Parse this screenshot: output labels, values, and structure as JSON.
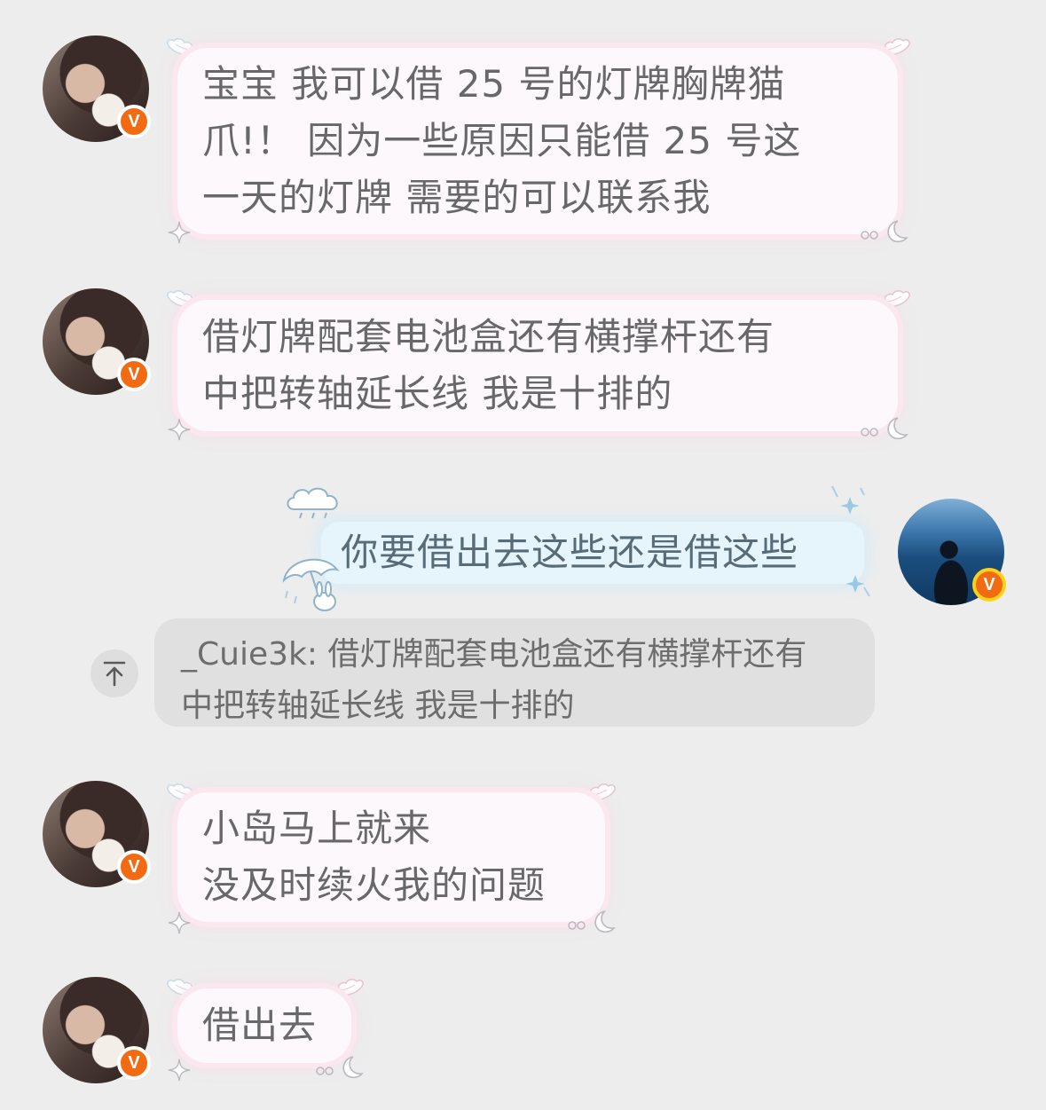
{
  "messages": [
    {
      "direction": "incoming",
      "lines": [
        "宝宝 我可以借 25 号的灯牌胸牌猫",
        "爪!！ 因为一些原因只能借 25 号这",
        "一天的灯牌 需要的可以联系我"
      ]
    },
    {
      "direction": "incoming",
      "lines": [
        "借灯牌配套电池盒还有横撑杆还有",
        "中把转轴延长线 我是十排的"
      ]
    },
    {
      "direction": "outgoing",
      "lines": [
        "你要借出去这些还是借这些"
      ]
    },
    {
      "direction": "incoming",
      "lines": [
        "小岛马上就来",
        "没及时续火我的问题"
      ]
    },
    {
      "direction": "incoming",
      "lines": [
        "借出去"
      ]
    }
  ],
  "quote": {
    "lines": [
      "_Cuie3k: 借灯牌配套电池盒还有横撑杆还有",
      "中把转轴延长线 我是十排的"
    ]
  },
  "badge_label": "V",
  "icons": {
    "badge": "verified-v-icon",
    "quote_jump": "arrow-up-to-top-icon",
    "wing": "angel-wing-icon",
    "sparkle": "sparkle-star-icon",
    "moon": "crescent-moon-icon",
    "cloud": "rain-cloud-icon",
    "umbrella": "umbrella-bunny-icon"
  },
  "colors": {
    "background": "#ededed",
    "incoming_bubble": "#fcf8fc",
    "incoming_glow": "#fbe7ee",
    "outgoing_bubble": "#e6f4fb",
    "badge_orange": "#f26a12",
    "quote_bg": "#e0e0e0"
  }
}
